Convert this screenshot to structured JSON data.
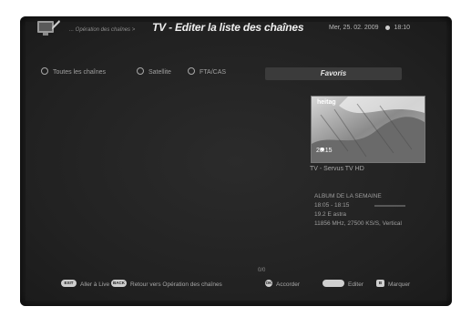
{
  "header": {
    "breadcrumb": "... Opération des chaînes >",
    "title": "TV - Editer la liste des chaînes",
    "date": "Mer, 25. 02. 2009",
    "time": "18:10"
  },
  "tabs": [
    {
      "label": "Toutes les chaînes",
      "selected": false
    },
    {
      "label": "Satellite",
      "selected": false
    },
    {
      "label": "FTA/CAS",
      "selected": false
    }
  ],
  "favorites_tab": {
    "label": "Favoris"
  },
  "preview": {
    "overlay_text": "heitag",
    "overlay_time": "20.15"
  },
  "channel": {
    "name": "TV - Servus TV HD"
  },
  "program_info": {
    "lines": [
      "ALBUM DE LA SEMAINE",
      "18:05 - 18:15",
      "19.2 E astra",
      "11856 MHz, 27500 KS/S, Vertical"
    ]
  },
  "counter": "0/0",
  "footer": [
    {
      "key": "EXIT",
      "label": "Aller à Live",
      "icon": "exit-key-icon"
    },
    {
      "key": "BACK",
      "label": "Retour vers Opération des chaînes",
      "icon": "back-key-icon"
    },
    {
      "key": "OK",
      "label": "Accorder",
      "icon": "ok-key-icon"
    },
    {
      "key": "red",
      "label": "Editer",
      "icon": "red-key-icon"
    },
    {
      "key": "B",
      "label": "Marquer",
      "icon": "b-key-icon"
    }
  ],
  "colors": {
    "background": "#222222",
    "text": "#a8a8a8",
    "title": "#f0f0f0",
    "active_tab": "#3b3b3b"
  }
}
